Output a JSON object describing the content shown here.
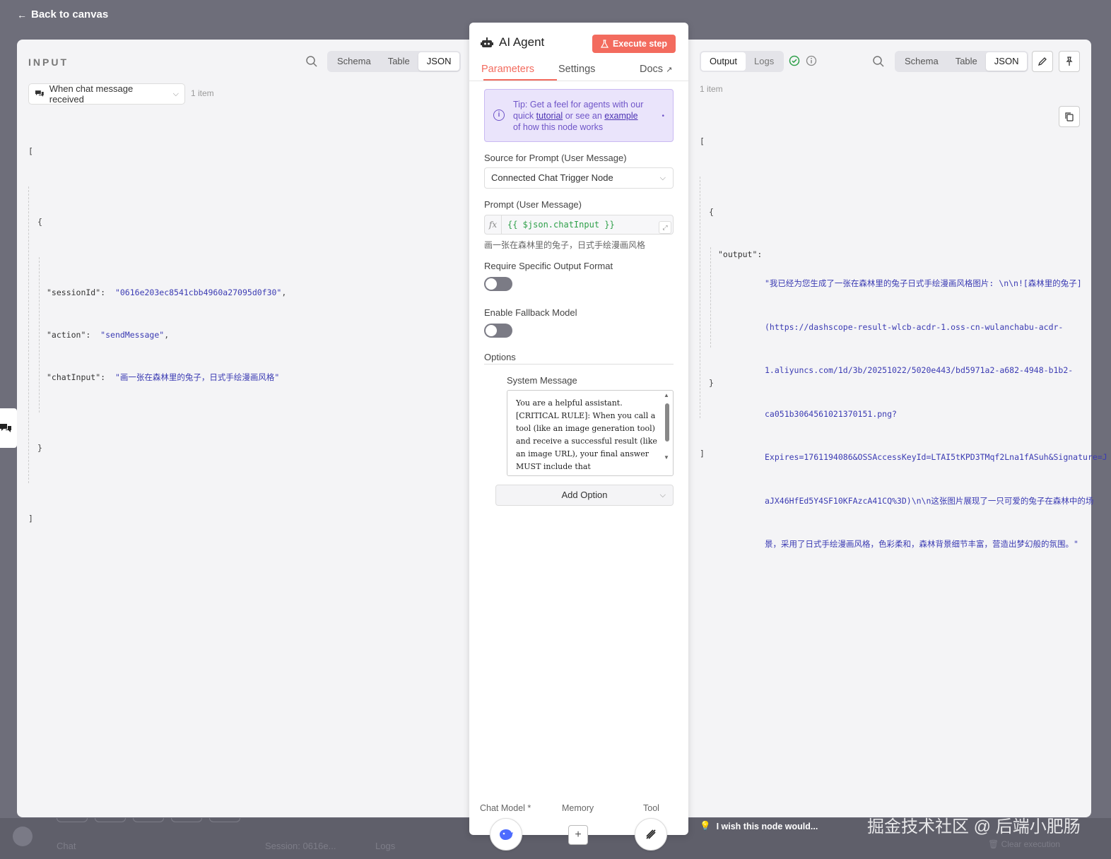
{
  "back_link": "Back to canvas",
  "input": {
    "title": "INPUT",
    "views": [
      "Schema",
      "Table",
      "JSON"
    ],
    "active_view": "JSON",
    "node_select": "When chat message received",
    "count": "1 item",
    "json": {
      "open": "[",
      "obj_open": "{",
      "rows": [
        {
          "key": "\"sessionId\":",
          "value": "\"0616e203ec8541cbb4960a27095d0f30\"",
          "tail": ","
        },
        {
          "key": "\"action\":",
          "value": "\"sendMessage\"",
          "tail": ","
        },
        {
          "key": "\"chatInput\":",
          "value": "\"画一张在森林里的兔子，日式手绘漫画风格\"",
          "tail": ""
        }
      ],
      "obj_close": "}",
      "close": "]"
    }
  },
  "node": {
    "title": "AI Agent",
    "execute_label": "Execute step",
    "tabs": {
      "parameters": "Parameters",
      "settings": "Settings",
      "docs": "Docs"
    },
    "tip": {
      "line1": "Tip: Get a feel for agents with our",
      "pre": "quick",
      "link1": "tutorial",
      "mid": "or see an",
      "link2": "example",
      "line3": "of how this node works"
    },
    "source_label": "Source for Prompt (User Message)",
    "source_value": "Connected Chat Trigger Node",
    "prompt_label": "Prompt (User Message)",
    "prompt_fx": "fx",
    "prompt_expr": "{{ $json.chatInput }}",
    "prompt_result": "画一张在森林里的兔子，日式手绘漫画风格",
    "require_label": "Require Specific Output Format",
    "fallback_label": "Enable Fallback Model",
    "options_label": "Options",
    "system_label": "System Message",
    "system_text": "You are a helpful assistant.\n[CRITICAL RULE]: When you call a tool (like an image generation tool) and receive a successful result (like an image URL), your final answer MUST include that",
    "add_option": "Add Option",
    "connectors": {
      "chat_model": "Chat Model *",
      "memory": "Memory",
      "tool": "Tool"
    },
    "plus": "+"
  },
  "output": {
    "tabs": [
      "Output",
      "Logs"
    ],
    "active_tab": "Output",
    "views": [
      "Schema",
      "Table",
      "JSON"
    ],
    "active_view": "JSON",
    "count": "1 item",
    "json": {
      "open": "[",
      "obj_open": "{",
      "key": "\"output\":",
      "lines": [
        "\"我已经为您生成了一张在森林里的兔子日式手绘漫画风格图片: \\n\\n![森林里的兔子]",
        "(https://dashscope-result-wlcb-acdr-1.oss-cn-wulanchabu-acdr-",
        "1.aliyuncs.com/1d/3b/20251022/5020e443/bd5971a2-a682-4948-b1b2-",
        "ca051b3064561021370151.png?",
        "Expires=1761194086&OSSAccessKeyId=LTAI5tKPD3TMqf2Lna1fASuh&Signature=J",
        "aJX46HfEd5Y4SF10KFAzcA41CQ%3D)\\n\\n这张图片展现了一只可爱的兔子在森林中的场",
        "景，采用了日式手绘漫画风格，色彩柔和，森林背景细节丰富，营造出梦幻般的氛围。\""
      ],
      "obj_close": "}",
      "close": "]"
    }
  },
  "footer": {
    "wish": "I wish this node would...",
    "chat": "Chat",
    "session": "Session: 0616e...",
    "logs": "Logs",
    "clear": "Clear execution",
    "watermark": "掘金技术社区 @ 后端小肥肠"
  },
  "colors": {
    "accent": "#f36b5e",
    "tip_bg": "#eae4fb",
    "tip_text": "#6f55c8",
    "success": "#2fa04a"
  }
}
